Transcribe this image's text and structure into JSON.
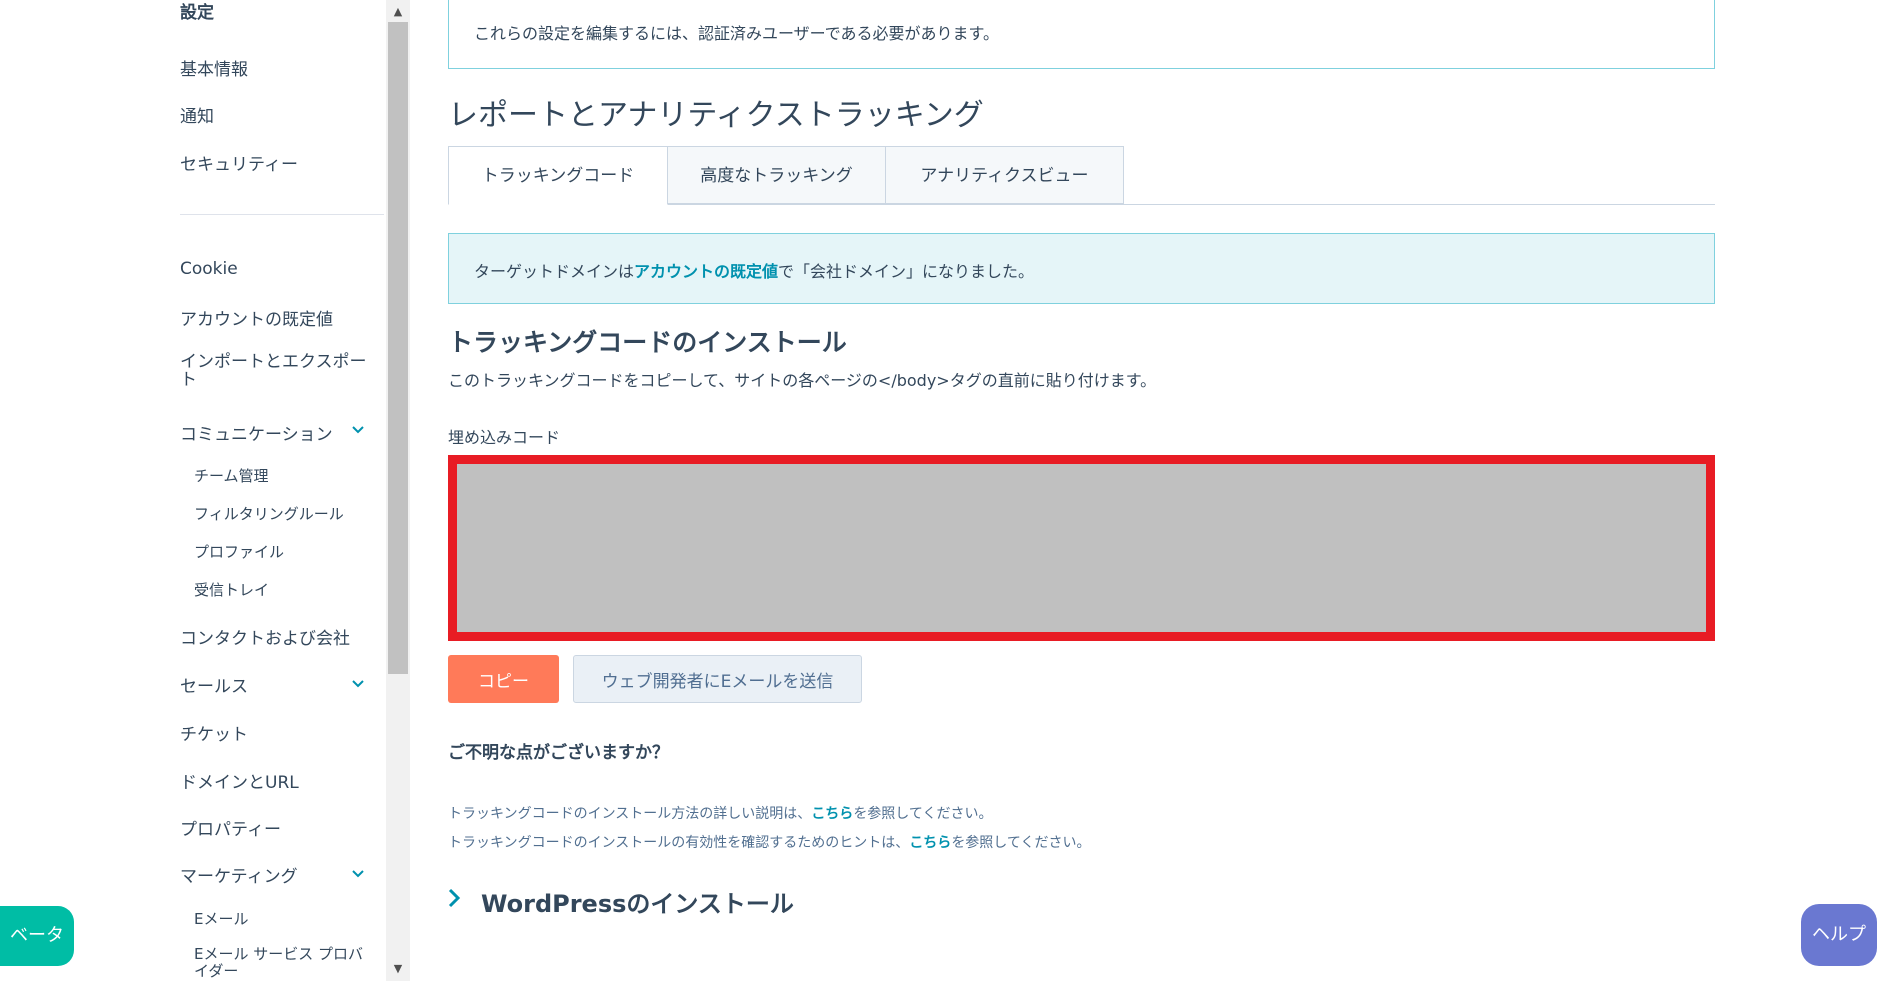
{
  "sidebar": {
    "header": "設定",
    "items": [
      {
        "label": "基本情報"
      },
      {
        "label": "通知"
      },
      {
        "label": "セキュリティー"
      },
      {
        "label": "Cookie"
      },
      {
        "label": "アカウントの既定値"
      },
      {
        "label": "インポートとエクスポート"
      },
      {
        "label": "コミュニケーション"
      },
      {
        "label": "チーム管理"
      },
      {
        "label": "フィルタリングルール"
      },
      {
        "label": "プロファイル"
      },
      {
        "label": "受信トレイ"
      },
      {
        "label": "コンタクトおよび会社"
      },
      {
        "label": "セールス"
      },
      {
        "label": "チケット"
      },
      {
        "label": "ドメインとURL"
      },
      {
        "label": "プロパティー"
      },
      {
        "label": "マーケティング"
      },
      {
        "label": "Eメール"
      },
      {
        "label": "Eメール サービス プロバイダー"
      }
    ]
  },
  "notice": {
    "text": "これらの設定を編集するには、認証済みユーザーである必要があります。"
  },
  "page_title": "レポートとアナリティクストラッキング",
  "tabs": [
    {
      "label": "トラッキングコード"
    },
    {
      "label": "高度なトラッキング"
    },
    {
      "label": "アナリティクスビュー"
    }
  ],
  "info": {
    "prefix": "ターゲットドメインは",
    "link": "アカウントの既定値",
    "suffix": "で「会社ドメイン」になりました。"
  },
  "install": {
    "title": "トラッキングコードのインストール",
    "description": "このトラッキングコードをコピーして、サイトの各ページの</body>タグの直前に貼り付けます。",
    "embed_label": "埋め込みコード",
    "copy_button": "コピー",
    "email_button": "ウェブ開発者にEメールを送信"
  },
  "help_section": {
    "title": "ご不明な点がございますか？",
    "line1_prefix": "トラッキングコードのインストール方法の詳しい説明は、",
    "line1_link": "こちら",
    "line1_suffix": "を参照してください。",
    "line2_prefix": "トラッキングコードのインストールの有効性を確認するためのヒントは、",
    "line2_link": "こちら",
    "line2_suffix": "を参照してください。"
  },
  "wordpress": {
    "title": "WordPressのインストール"
  },
  "floating": {
    "beta": "ベータ",
    "help": "ヘルプ"
  },
  "colors": {
    "accent": "#0091ae",
    "primary_button": "#ff7a59",
    "highlight_border": "#e81c24",
    "beta": "#00bda5",
    "help": "#6a78d1"
  }
}
